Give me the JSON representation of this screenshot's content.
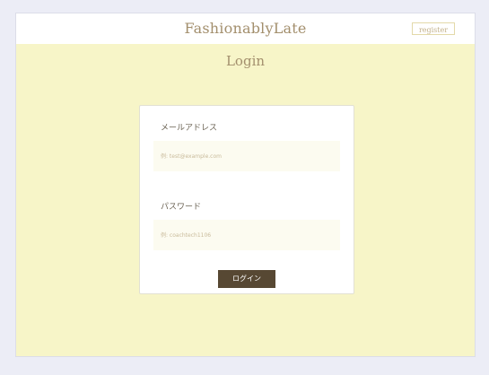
{
  "header": {
    "brand": "FashionablyLate",
    "register_label": "register"
  },
  "page": {
    "title": "Login"
  },
  "form": {
    "email": {
      "label": "メールアドレス",
      "value": "",
      "placeholder": "例: test@example.com"
    },
    "password": {
      "label": "パスワード",
      "value": "",
      "placeholder": "例: coachtech1106"
    },
    "submit_label": "ログイン"
  },
  "colors": {
    "page_background": "#ecedf6",
    "content_background": "#f7f5c8",
    "brand_text": "#a38f6d",
    "button_background": "#574833",
    "input_background": "#fcfbf0"
  }
}
